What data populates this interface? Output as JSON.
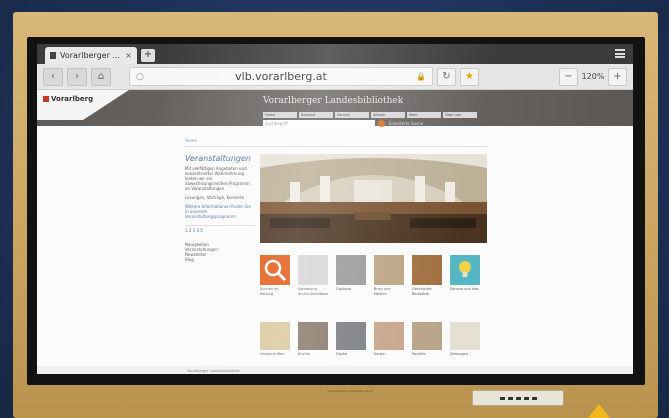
{
  "browser": {
    "tab_title": "Vorarlberger ...",
    "tab_close": "×",
    "new_tab": "+",
    "url": "vlb.vorarlberg.at",
    "zoom": "120%",
    "zoom_minus": "−",
    "zoom_plus": "+",
    "back_glyph": "‹",
    "forward_glyph": "›",
    "home_glyph": "⌂",
    "search_glyph": "○",
    "lock_glyph": "🔒",
    "reload_glyph": "↻",
    "star_glyph": "★"
  },
  "site": {
    "logo_text": "Vorarlberg",
    "title": "Vorarlberger Landesbibliothek",
    "nav": [
      "Home",
      "Bestand",
      "Service",
      "Wissen",
      "Mehr",
      "Über uns"
    ],
    "search_placeholder": "Suchbegriff",
    "search_extra": "Erweiterte Suche",
    "breadcrumb": "Home"
  },
  "sidebar": {
    "heading": "Veranstaltungen",
    "paragraph1": "Mit vielfältigen Angeboten und konzentrierter Wahrnehmung bieten wir ein abwechslungsreiches Programm an Veranstaltungen.",
    "paragraph2": "Lesungen, Vorträge, Konzerte",
    "link": "Weitere Informationen finden Sie in unserem Veranstaltungsprogramm",
    "pager": "1 2 3 4 5",
    "links": [
      "Neuigkeiten",
      "Veranstaltungen",
      "Newsletter",
      "Blog"
    ]
  },
  "tiles_row1": [
    {
      "caption": "Suchen im Katalog",
      "color": "#e25a16"
    },
    {
      "caption": "Sammlung Archiv Nachlässe",
      "color": "#d6d6d6"
    },
    {
      "caption": "Digitales",
      "color": "#9a9a9a"
    },
    {
      "caption": "Buch und Medien",
      "color": "#bba583"
    },
    {
      "caption": "Geschichte Bibliothek",
      "color": "#a07040"
    },
    {
      "caption": "Service und Info",
      "color": "#56b7c4"
    }
  ],
  "tiles_row2": [
    {
      "caption": "Handschriften",
      "color": "#d9c89a"
    },
    {
      "caption": "Bücher",
      "color": "#8a7a6a"
    },
    {
      "caption": "Digital",
      "color": "#7a7d82"
    },
    {
      "caption": "Karten",
      "color": "#c9a48a"
    },
    {
      "caption": "Porträts",
      "color": "#b8a488"
    },
    {
      "caption": "Zeitungen",
      "color": "#e5e0d2"
    }
  ],
  "footer": {
    "left": "Vorarlberger Landesbibliothek",
    "chin": "Vorarlberger Landesbibliothek"
  }
}
